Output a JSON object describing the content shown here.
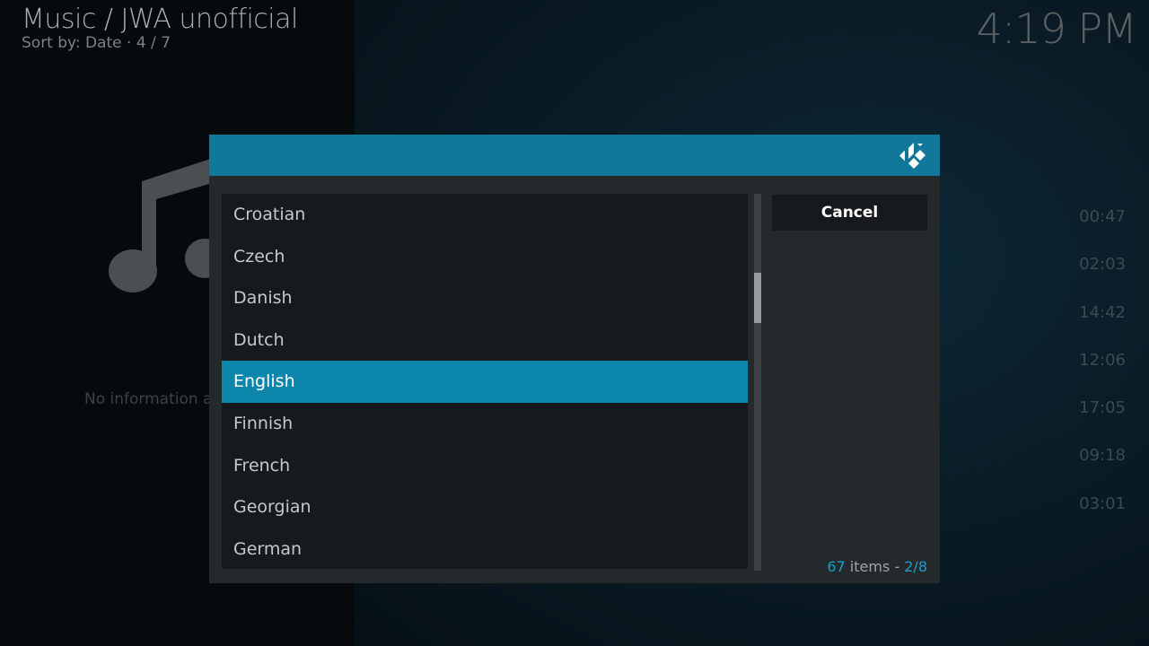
{
  "header": {
    "title": "Music / JWA unofficial",
    "subtitle": "Sort by: Date  ·  4 / 7",
    "clock": "4:19 PM"
  },
  "info": {
    "no_info_text": "No information available"
  },
  "durations": [
    "00:47",
    "02:03",
    "14:42",
    "12:06",
    "17:05",
    "09:18",
    "03:01"
  ],
  "dialog": {
    "logo_icon": "kodi-logo-icon",
    "items": [
      "Croatian",
      "Czech",
      "Danish",
      "Dutch",
      "English",
      "Finnish",
      "French",
      "Georgian",
      "German"
    ],
    "selected_item": "English",
    "scroll_position": 0.25,
    "cancel_label": "Cancel",
    "total_items": "67",
    "items_label": "items",
    "separator": "-",
    "page": "2/8"
  },
  "colors": {
    "accent": "#127899",
    "selected": "#0d86ac",
    "count_accent": "#1e9bcc"
  }
}
